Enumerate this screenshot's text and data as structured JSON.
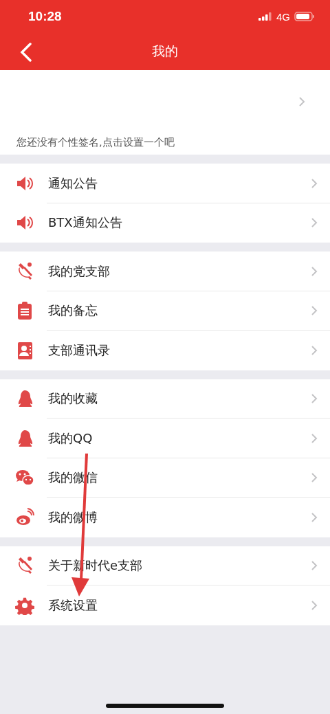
{
  "status_bar": {
    "time": "10:28",
    "network": "4G"
  },
  "nav_bar": {
    "title": "我的"
  },
  "profile": {
    "signature": "您还没有个性签名,点击设置一个吧"
  },
  "sections": [
    {
      "items": [
        {
          "label": "通知公告"
        },
        {
          "label": "BTX通知公告"
        }
      ]
    },
    {
      "items": [
        {
          "label": "我的党支部"
        },
        {
          "label": "我的备忘"
        },
        {
          "label": "支部通讯录"
        }
      ]
    },
    {
      "items": [
        {
          "label": "我的收藏"
        },
        {
          "label": "我的QQ"
        },
        {
          "label": "我的微信"
        },
        {
          "label": "我的微博"
        }
      ]
    },
    {
      "items": [
        {
          "label": "关于新时代e支部"
        },
        {
          "label": "系统设置"
        }
      ]
    }
  ]
}
